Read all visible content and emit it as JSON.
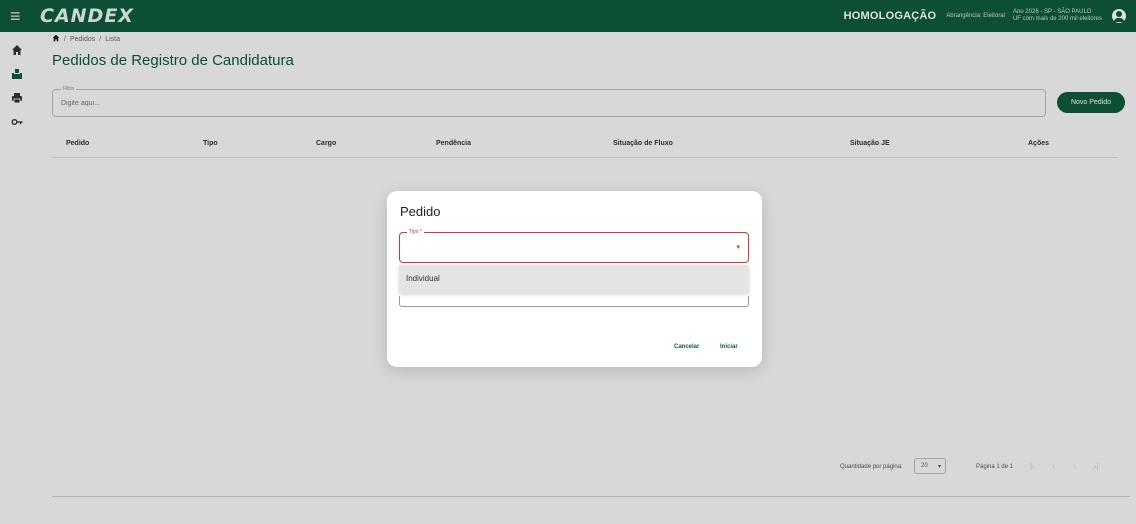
{
  "header": {
    "menu_icon": "menu-icon",
    "logo": "CANDEX",
    "environment": "HOMOLOGAÇÃO",
    "mode": "Abrangência: Eleitoral",
    "election_line1": "Ano 2026 - SP - SÃO PAULO",
    "election_line2": "UF com mais de 200 mil eleitores",
    "user_icon": "account-circle-icon"
  },
  "sidebar": {
    "items": [
      {
        "icon": "home-icon"
      },
      {
        "icon": "ballot-box-icon"
      },
      {
        "icon": "printer-icon"
      },
      {
        "icon": "key-icon"
      }
    ]
  },
  "breadcrumb": {
    "home_icon": "home-icon",
    "items": [
      "Pedidos",
      "Lista"
    ],
    "separator": "/"
  },
  "page": {
    "title": "Pedidos de Registro de Candidatura"
  },
  "filter": {
    "label": "Filtro",
    "placeholder": "Digite aqui..."
  },
  "actions": {
    "new_order": "Novo Pedido"
  },
  "table": {
    "columns": [
      "Pedido",
      "Tipo",
      "Cargo",
      "Pendência",
      "Situação de Fluxo",
      "Situação JE",
      "Ações"
    ]
  },
  "paginator": {
    "items_per_page_label": "Quantidade por página:",
    "items_per_page_value": "20",
    "range_label": "Página 1 de 1"
  },
  "modal": {
    "title": "Pedido",
    "type_label": "Tipo *",
    "options": [
      "Individual"
    ],
    "cancel_label": "Cancelar",
    "submit_label": "Iniciar"
  },
  "colors": {
    "primary": "#0e5b3c",
    "error": "#d33333"
  }
}
